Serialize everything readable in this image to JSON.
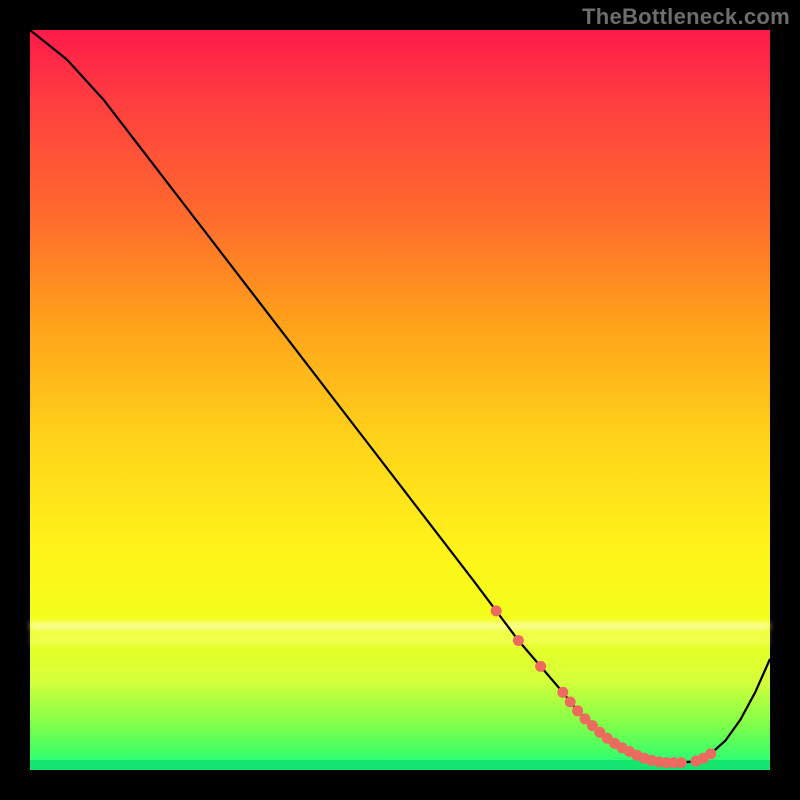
{
  "watermark": "TheBottleneck.com",
  "chart_data": {
    "type": "line",
    "title": "",
    "xlabel": "",
    "ylabel": "",
    "xlim": [
      0,
      100
    ],
    "ylim": [
      0,
      100
    ],
    "grid": false,
    "series": [
      {
        "name": "bottleneck-curve",
        "x": [
          0,
          5,
          10,
          15,
          20,
          25,
          30,
          35,
          40,
          45,
          50,
          55,
          60,
          63,
          66,
          69,
          72,
          74,
          76,
          78,
          80,
          82,
          84,
          86,
          88,
          90,
          92,
          94,
          96,
          98,
          100
        ],
        "y": [
          100,
          96,
          90.5,
          84,
          77.5,
          71,
          64.5,
          58,
          51.5,
          45,
          38.5,
          32,
          25.5,
          21.5,
          17.5,
          14,
          10.5,
          8,
          6,
          4.3,
          3,
          2,
          1.3,
          1,
          1,
          1.2,
          2.2,
          4,
          6.8,
          10.5,
          15
        ]
      }
    ],
    "markers": {
      "name": "fit-region-dots",
      "color": "#ec6a5e",
      "x": [
        63,
        66,
        69,
        72,
        73,
        74,
        75,
        76,
        77,
        78,
        79,
        80,
        81,
        82,
        83,
        84,
        85,
        86,
        87,
        88,
        90,
        91,
        92
      ],
      "y": [
        21.5,
        17.5,
        14,
        10.5,
        9.2,
        8,
        6.9,
        6,
        5.1,
        4.3,
        3.6,
        3,
        2.5,
        2,
        1.6,
        1.3,
        1.1,
        1,
        1,
        1,
        1.2,
        1.6,
        2.2
      ]
    },
    "bands": [
      {
        "name": "pale-band",
        "y_center": 80,
        "color_hint": "whitish"
      },
      {
        "name": "green-strip",
        "y_center": 0,
        "color_hint": "green"
      }
    ],
    "background": {
      "type": "vertical-gradient",
      "stops": [
        {
          "pos": 0,
          "color": "#ff1a4a"
        },
        {
          "pos": 25,
          "color": "#ff6a2d"
        },
        {
          "pos": 55,
          "color": "#ffd21a"
        },
        {
          "pos": 80,
          "color": "#f3ff1a"
        },
        {
          "pos": 100,
          "color": "#1aff7a"
        }
      ]
    }
  }
}
